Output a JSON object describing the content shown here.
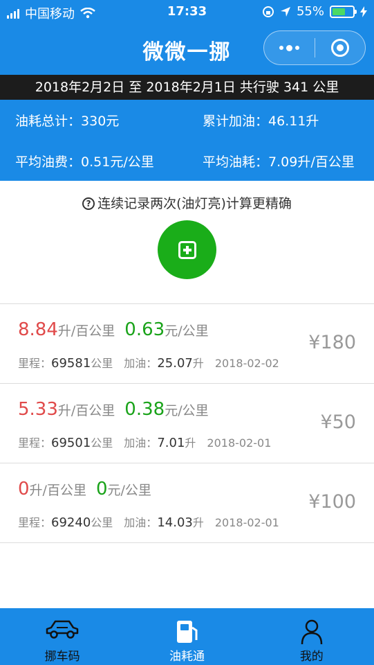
{
  "status_bar": {
    "carrier": "中国移动",
    "time": "17:33",
    "battery_percent": "55%",
    "icons": [
      "signal-icon",
      "wifi-icon",
      "rotation-lock-icon",
      "location-icon",
      "battery-icon",
      "charging-icon"
    ]
  },
  "nav": {
    "title": "微微一挪",
    "capsule_icons": [
      "more-icon",
      "close-target-icon"
    ]
  },
  "date_range": "2018年2月2日 至 2018年2月1日 共行驶 341 公里",
  "summary": {
    "total_cost_label": "油耗总计：",
    "total_cost_value": "330元",
    "total_fuel_label": "累计加油：",
    "total_fuel_value": "46.11升",
    "avg_cost_label": "平均油费：",
    "avg_cost_value": "0.51元/公里",
    "avg_consumption_label": "平均油耗：",
    "avg_consumption_value": "7.09升/百公里"
  },
  "tip": "连续记录两次(油灯亮)计算更精确",
  "records": [
    {
      "consumption": "8.84",
      "consumption_unit": "升/百公里",
      "cost": "0.63",
      "cost_unit": "元/公里",
      "mileage_label": "里程：",
      "mileage": "69581",
      "mileage_unit": "公里",
      "fuel_label": "加油：",
      "fuel": "25.07",
      "fuel_unit": "升",
      "date": "2018-02-02",
      "price": "¥180"
    },
    {
      "consumption": "5.33",
      "consumption_unit": "升/百公里",
      "cost": "0.38",
      "cost_unit": "元/公里",
      "mileage_label": "里程：",
      "mileage": "69501",
      "mileage_unit": "公里",
      "fuel_label": "加油：",
      "fuel": "7.01",
      "fuel_unit": "升",
      "date": "2018-02-01",
      "price": "¥50"
    },
    {
      "consumption": "0",
      "consumption_unit": "升/百公里",
      "cost": "0",
      "cost_unit": "元/公里",
      "mileage_label": "里程：",
      "mileage": "69240",
      "mileage_unit": "公里",
      "fuel_label": "加油：",
      "fuel": "14.03",
      "fuel_unit": "升",
      "date": "2018-02-01",
      "price": "¥100"
    }
  ],
  "tabs": [
    {
      "label": "挪车码",
      "icon": "car-icon"
    },
    {
      "label": "油耗通",
      "icon": "fuel-pump-icon"
    },
    {
      "label": "我的",
      "icon": "user-icon"
    }
  ],
  "colors": {
    "primary": "#1a8ae6",
    "add_button": "#1aad19",
    "consumption_red": "#e04a4a",
    "cost_green": "#1aa31a"
  }
}
